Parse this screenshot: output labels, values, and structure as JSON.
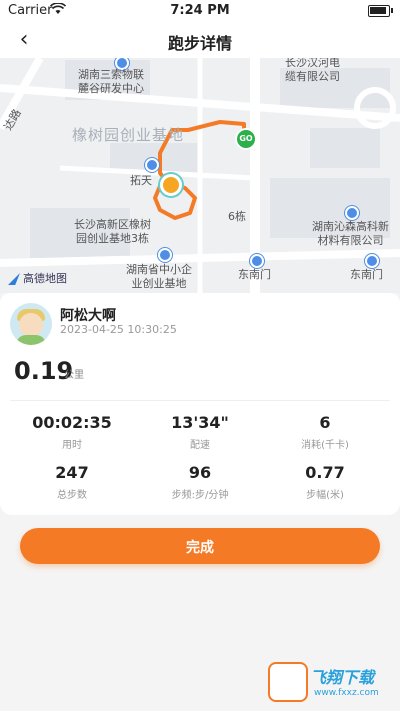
{
  "status": {
    "carrier": "Carrier",
    "time": "7:24 PM"
  },
  "nav": {
    "back_icon": "‹",
    "title": "跑步详情"
  },
  "map": {
    "labels": {
      "a": "长沙汉河电\n缆有限公司",
      "b": "湖南三索物联\n麓谷研发中心",
      "c": "橡树园创业基地",
      "d": "拓天",
      "e": "长沙高新区橡树\n园创业基地3栋",
      "f": "6栋",
      "g": "湖南沁森高科新\n材料有限公司",
      "h": "东南门",
      "i": "东南门",
      "j": "湖南省中小企\n业创业基地",
      "k": "达路"
    },
    "start_marker": "GO",
    "provider": "高德地图"
  },
  "run": {
    "username": "阿松大啊",
    "datetime": "2023-04-25 10:30:25",
    "distance": "0.19",
    "distance_unit": "公里",
    "stats": [
      {
        "value": "00:02:35",
        "label": "用时"
      },
      {
        "value": "13'34\"",
        "label": "配速"
      },
      {
        "value": "6",
        "label": "消耗(千卡)"
      },
      {
        "value": "247",
        "label": "总步数"
      },
      {
        "value": "96",
        "label": "步频:步/分钟"
      },
      {
        "value": "0.77",
        "label": "步幅(米)"
      }
    ]
  },
  "actions": {
    "done_label": "完成"
  },
  "watermark": {
    "title": "飞翔下载",
    "url": "www.fxxz.com"
  },
  "colors": {
    "accent": "#f47a25",
    "route": "#f47a25",
    "start": "#2bb04a"
  }
}
